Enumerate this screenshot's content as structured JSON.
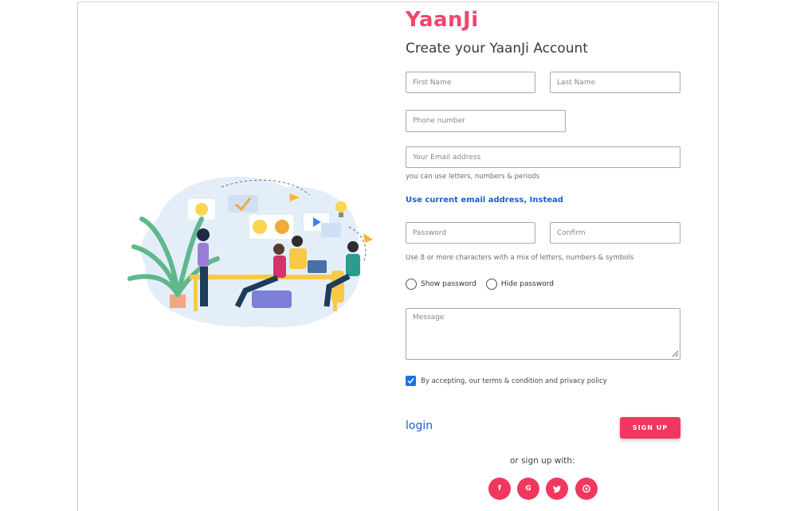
{
  "brand": {
    "name": "YaanJi",
    "color": "#f0466c"
  },
  "heading": "Create your YaanJi Account",
  "fields": {
    "first_name": {
      "placeholder": "First Name",
      "value": ""
    },
    "last_name": {
      "placeholder": "Last Name",
      "value": ""
    },
    "phone": {
      "placeholder": "Phone number",
      "value": ""
    },
    "email": {
      "placeholder": "Your Email address",
      "value": ""
    },
    "email_hint": "you can use letters, numbers & periods",
    "use_current_email": "Use current email address, Instead",
    "password": {
      "placeholder": "Password",
      "value": ""
    },
    "confirm": {
      "placeholder": "Confirm",
      "value": ""
    },
    "password_hint": "Use 8 or more characters with a mix of letters, numbers & symbols",
    "message": {
      "placeholder": "Message",
      "value": ""
    }
  },
  "radios": {
    "show_password": "Show password",
    "hide_password": "Hide password"
  },
  "terms": {
    "label": "By accepting, our terms & condition and privacy policy",
    "checked": true
  },
  "actions": {
    "login_label": "login",
    "signup_label": "SIGN UP"
  },
  "social": {
    "prompt": "or sign up with:",
    "items": [
      {
        "icon": "facebook-icon",
        "glyph": "f"
      },
      {
        "icon": "google-icon",
        "glyph": "G"
      },
      {
        "icon": "twitter-icon",
        "glyph": "t"
      },
      {
        "icon": "github-icon",
        "glyph": "g"
      }
    ]
  },
  "colors": {
    "accent": "#f0375f",
    "link": "#1a5fcf",
    "checkbox": "#1a73e8"
  }
}
